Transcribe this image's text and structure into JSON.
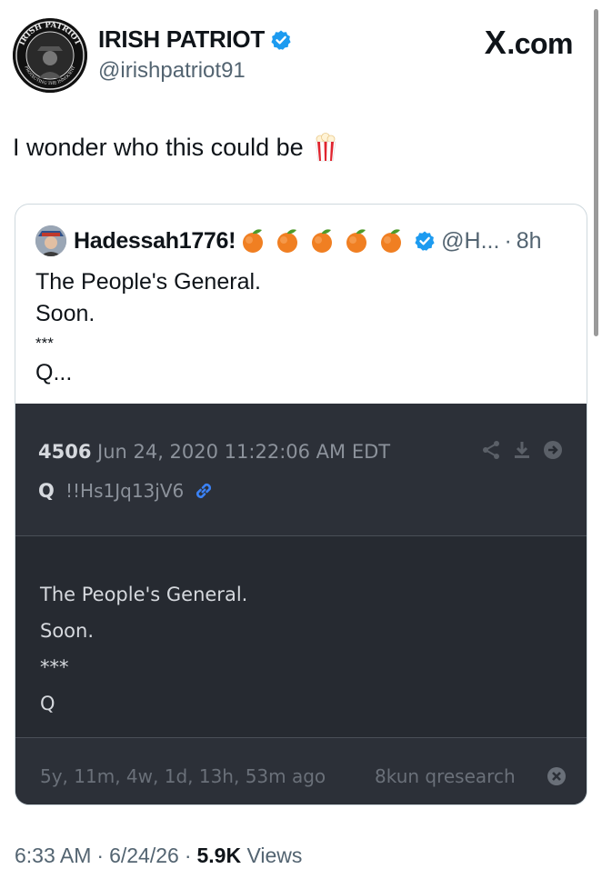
{
  "post": {
    "author_name": "IRISH PATRIOT",
    "author_handle": "@irishpatriot91",
    "site_label_x": "X",
    "site_label_rest": ".com",
    "avatar_ring_text_top": "IRISH PATRIOT",
    "avatar_ring_text_bottom": "PROTECTING THE INNOCENT",
    "text": "I wonder who this could be",
    "text_emoji": "popcorn-icon"
  },
  "quote": {
    "name": "Hadessah1776!",
    "emoji_count_label": "peach-icon x5",
    "handle": "@H...",
    "sep": "·",
    "time": "8h",
    "lines": [
      "The People's General.",
      "Soon.",
      "***",
      "Q..."
    ]
  },
  "q_image": {
    "post_number": "4506",
    "date": "Jun 24, 2020 11:22:06 AM EDT",
    "q_label": "Q",
    "tripcode": "!!Hs1Jq13jV6",
    "lines": [
      "The People's General.",
      "Soon.",
      "***",
      "Q"
    ],
    "ago": "5y, 11m, 4w, 1d, 13h, 53m ago",
    "board": "8kun qresearch"
  },
  "meta": {
    "time": "6:33 AM",
    "sep1": "·",
    "date": "6/24/26",
    "sep2": "·",
    "views_count": "5.9K",
    "views_label": "Views"
  },
  "colors": {
    "verified": "#1d9bf0",
    "secondary_text": "#536471",
    "card_dark": "#262a31",
    "link_blue": "#3b82f6"
  }
}
